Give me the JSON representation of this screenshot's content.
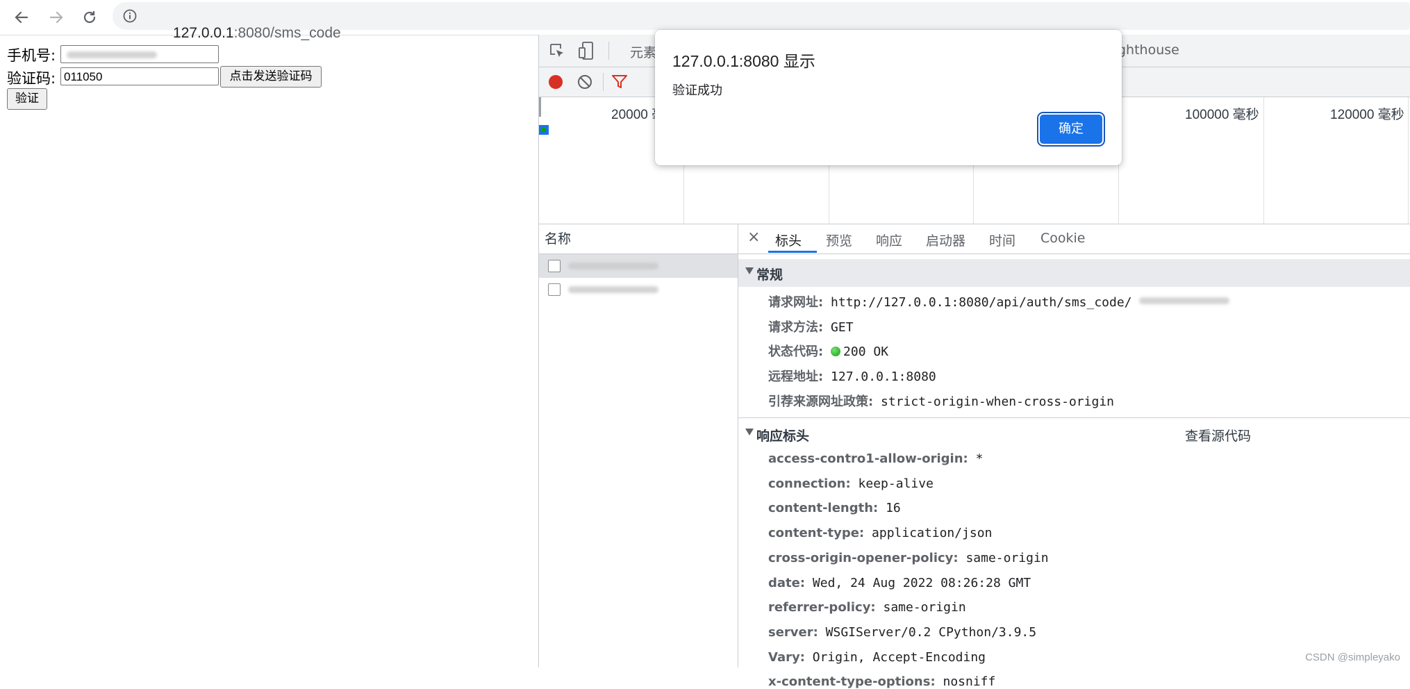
{
  "browser": {
    "url_host": "127.0.0.1",
    "url_path": ":8080/sms_code",
    "back_icon": "arrow-left-icon",
    "forward_icon": "arrow-right-icon",
    "reload_icon": "reload-icon",
    "info_icon": "info-icon"
  },
  "form": {
    "phone_label": "手机号:",
    "code_label": "验证码:",
    "code_value": "011050",
    "send_button": "点击发送验证码",
    "verify_button": "验证"
  },
  "devtools": {
    "tabs": [
      "元素",
      "ghthouse"
    ],
    "overview_labels": [
      "20000 毫",
      "100000 毫秒",
      "120000 毫秒"
    ],
    "request_list_header": "名称",
    "detail_tabs": [
      "标头",
      "预览",
      "响应",
      "启动器",
      "时间",
      "Cookie"
    ],
    "close_icon": "×",
    "general": {
      "title": "常规",
      "rows": [
        {
          "key": "请求网址:",
          "value": "http://127.0.0.1:8080/api/auth/sms_code/"
        },
        {
          "key": "请求方法:",
          "value": "GET"
        },
        {
          "key": "状态代码:",
          "value": "200 OK"
        },
        {
          "key": "远程地址:",
          "value": "127.0.0.1:8080"
        },
        {
          "key": "引荐来源网址政策:",
          "value": "strict-origin-when-cross-origin"
        }
      ]
    },
    "response_headers": {
      "title": "响应标头",
      "view_source": "查看源代码",
      "rows": [
        {
          "key": "access-contro1-allow-origin:",
          "value": "*"
        },
        {
          "key": "connection:",
          "value": "keep-alive"
        },
        {
          "key": "content-length:",
          "value": "16"
        },
        {
          "key": "content-type:",
          "value": "application/json"
        },
        {
          "key": "cross-origin-opener-policy:",
          "value": "same-origin"
        },
        {
          "key": "date:",
          "value": "Wed, 24 Aug 2022 08:26:28 GMT"
        },
        {
          "key": "referrer-policy:",
          "value": "same-origin"
        },
        {
          "key": "server:",
          "value": "WSGIServer/0.2 CPython/3.9.5"
        },
        {
          "key": "Vary:",
          "value": "Origin, Accept-Encoding"
        },
        {
          "key": "x-content-type-options:",
          "value": "nosniff"
        }
      ]
    }
  },
  "alert": {
    "title": "127.0.0.1:8080 显示",
    "message": "验证成功",
    "ok_button": "确定"
  },
  "watermark": "CSDN @simpleyako",
  "colors": {
    "accent": "#1a73e8",
    "record": "#d93025",
    "filter": "#d93025",
    "status_ok": "#0ca20c"
  }
}
